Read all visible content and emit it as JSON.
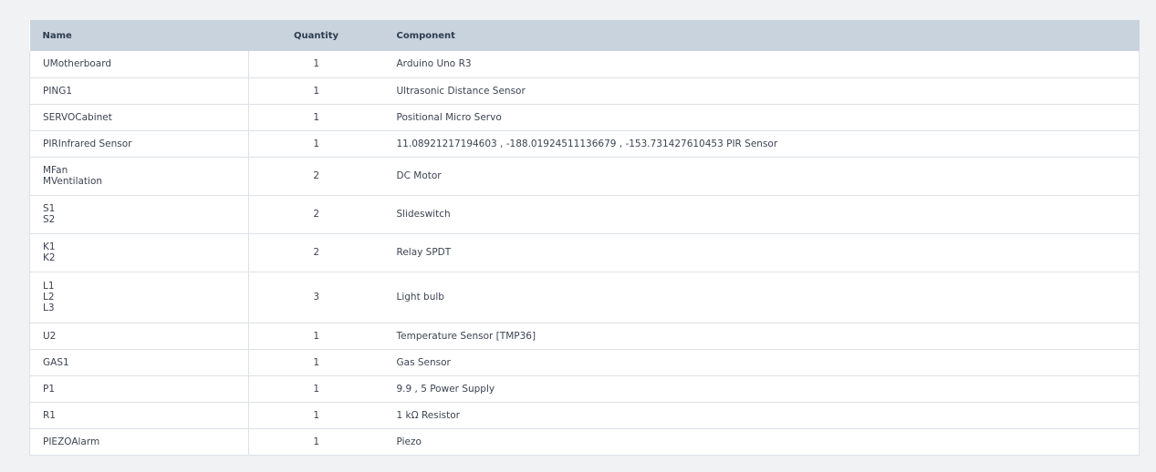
{
  "table": {
    "headers": {
      "name": "Name",
      "quantity": "Quantity",
      "component": "Component"
    },
    "rows": [
      {
        "names": [
          "UMotherboard"
        ],
        "quantity": "1",
        "component": "Arduino Uno R3"
      },
      {
        "names": [
          "PING1"
        ],
        "quantity": "1",
        "component": "Ultrasonic Distance Sensor"
      },
      {
        "names": [
          "SERVOCabinet"
        ],
        "quantity": "1",
        "component": "Positional Micro Servo"
      },
      {
        "names": [
          "PIRInfrared Sensor"
        ],
        "quantity": "1",
        "component": "11.08921217194603 , -188.01924511136679 , -153.731427610453 PIR Sensor"
      },
      {
        "names": [
          "MFan",
          "MVentilation"
        ],
        "quantity": "2",
        "component": "DC Motor"
      },
      {
        "names": [
          "S1",
          "S2"
        ],
        "quantity": "2",
        "component": "Slideswitch"
      },
      {
        "names": [
          "K1",
          "K2"
        ],
        "quantity": "2",
        "component": "Relay SPDT"
      },
      {
        "names": [
          "L1",
          "L2",
          "L3"
        ],
        "quantity": "3",
        "component": "Light bulb"
      },
      {
        "names": [
          "U2"
        ],
        "quantity": "1",
        "component": "Temperature Sensor [TMP36]"
      },
      {
        "names": [
          "GAS1"
        ],
        "quantity": "1",
        "component": "Gas Sensor"
      },
      {
        "names": [
          "P1"
        ],
        "quantity": "1",
        "component": "9.9 , 5 Power Supply"
      },
      {
        "names": [
          "R1"
        ],
        "quantity": "1",
        "component": "1 kΩ Resistor"
      },
      {
        "names": [
          "PIEZOAlarm"
        ],
        "quantity": "1",
        "component": "Piezo"
      }
    ]
  }
}
